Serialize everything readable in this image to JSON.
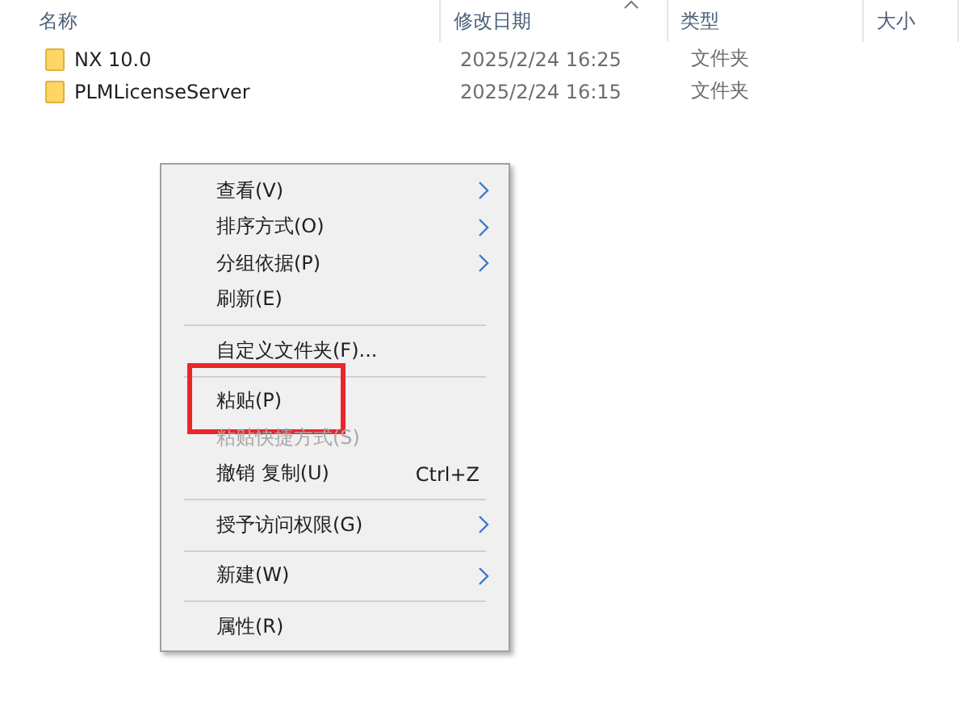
{
  "columns": [
    "名称",
    "修改日期",
    "类型",
    "大小"
  ],
  "rows": [
    {
      "name": "NX 10.0",
      "modified": "2025/2/24 16:25",
      "type": "文件夹"
    },
    {
      "name": "PLMLicenseServer",
      "modified": "2025/2/24 16:15",
      "type": "文件夹"
    }
  ],
  "context_menu": {
    "items": [
      {
        "kind": "item",
        "label": "查看(V)",
        "submenu": true,
        "disabled": false
      },
      {
        "kind": "item",
        "label": "排序方式(O)",
        "submenu": true,
        "disabled": false
      },
      {
        "kind": "item",
        "label": "分组依据(P)",
        "submenu": true,
        "disabled": false
      },
      {
        "kind": "item",
        "label": "刷新(E)",
        "submenu": false,
        "disabled": false
      },
      {
        "kind": "separator"
      },
      {
        "kind": "item",
        "label": "自定义文件夹(F)...",
        "submenu": false,
        "disabled": false
      },
      {
        "kind": "separator"
      },
      {
        "kind": "item",
        "label": "粘贴(P)",
        "submenu": false,
        "disabled": false,
        "highlighted": true
      },
      {
        "kind": "item",
        "label": "粘贴快捷方式(S)",
        "submenu": false,
        "disabled": true
      },
      {
        "kind": "item",
        "label": "撤销 复制(U)",
        "shortcut": "Ctrl+Z",
        "submenu": false,
        "disabled": false
      },
      {
        "kind": "separator"
      },
      {
        "kind": "item",
        "label": "授予访问权限(G)",
        "submenu": true,
        "disabled": false
      },
      {
        "kind": "separator"
      },
      {
        "kind": "item",
        "label": "新建(W)",
        "submenu": true,
        "disabled": false
      },
      {
        "kind": "separator"
      },
      {
        "kind": "item",
        "label": "属性(R)",
        "submenu": false,
        "disabled": false
      }
    ]
  }
}
